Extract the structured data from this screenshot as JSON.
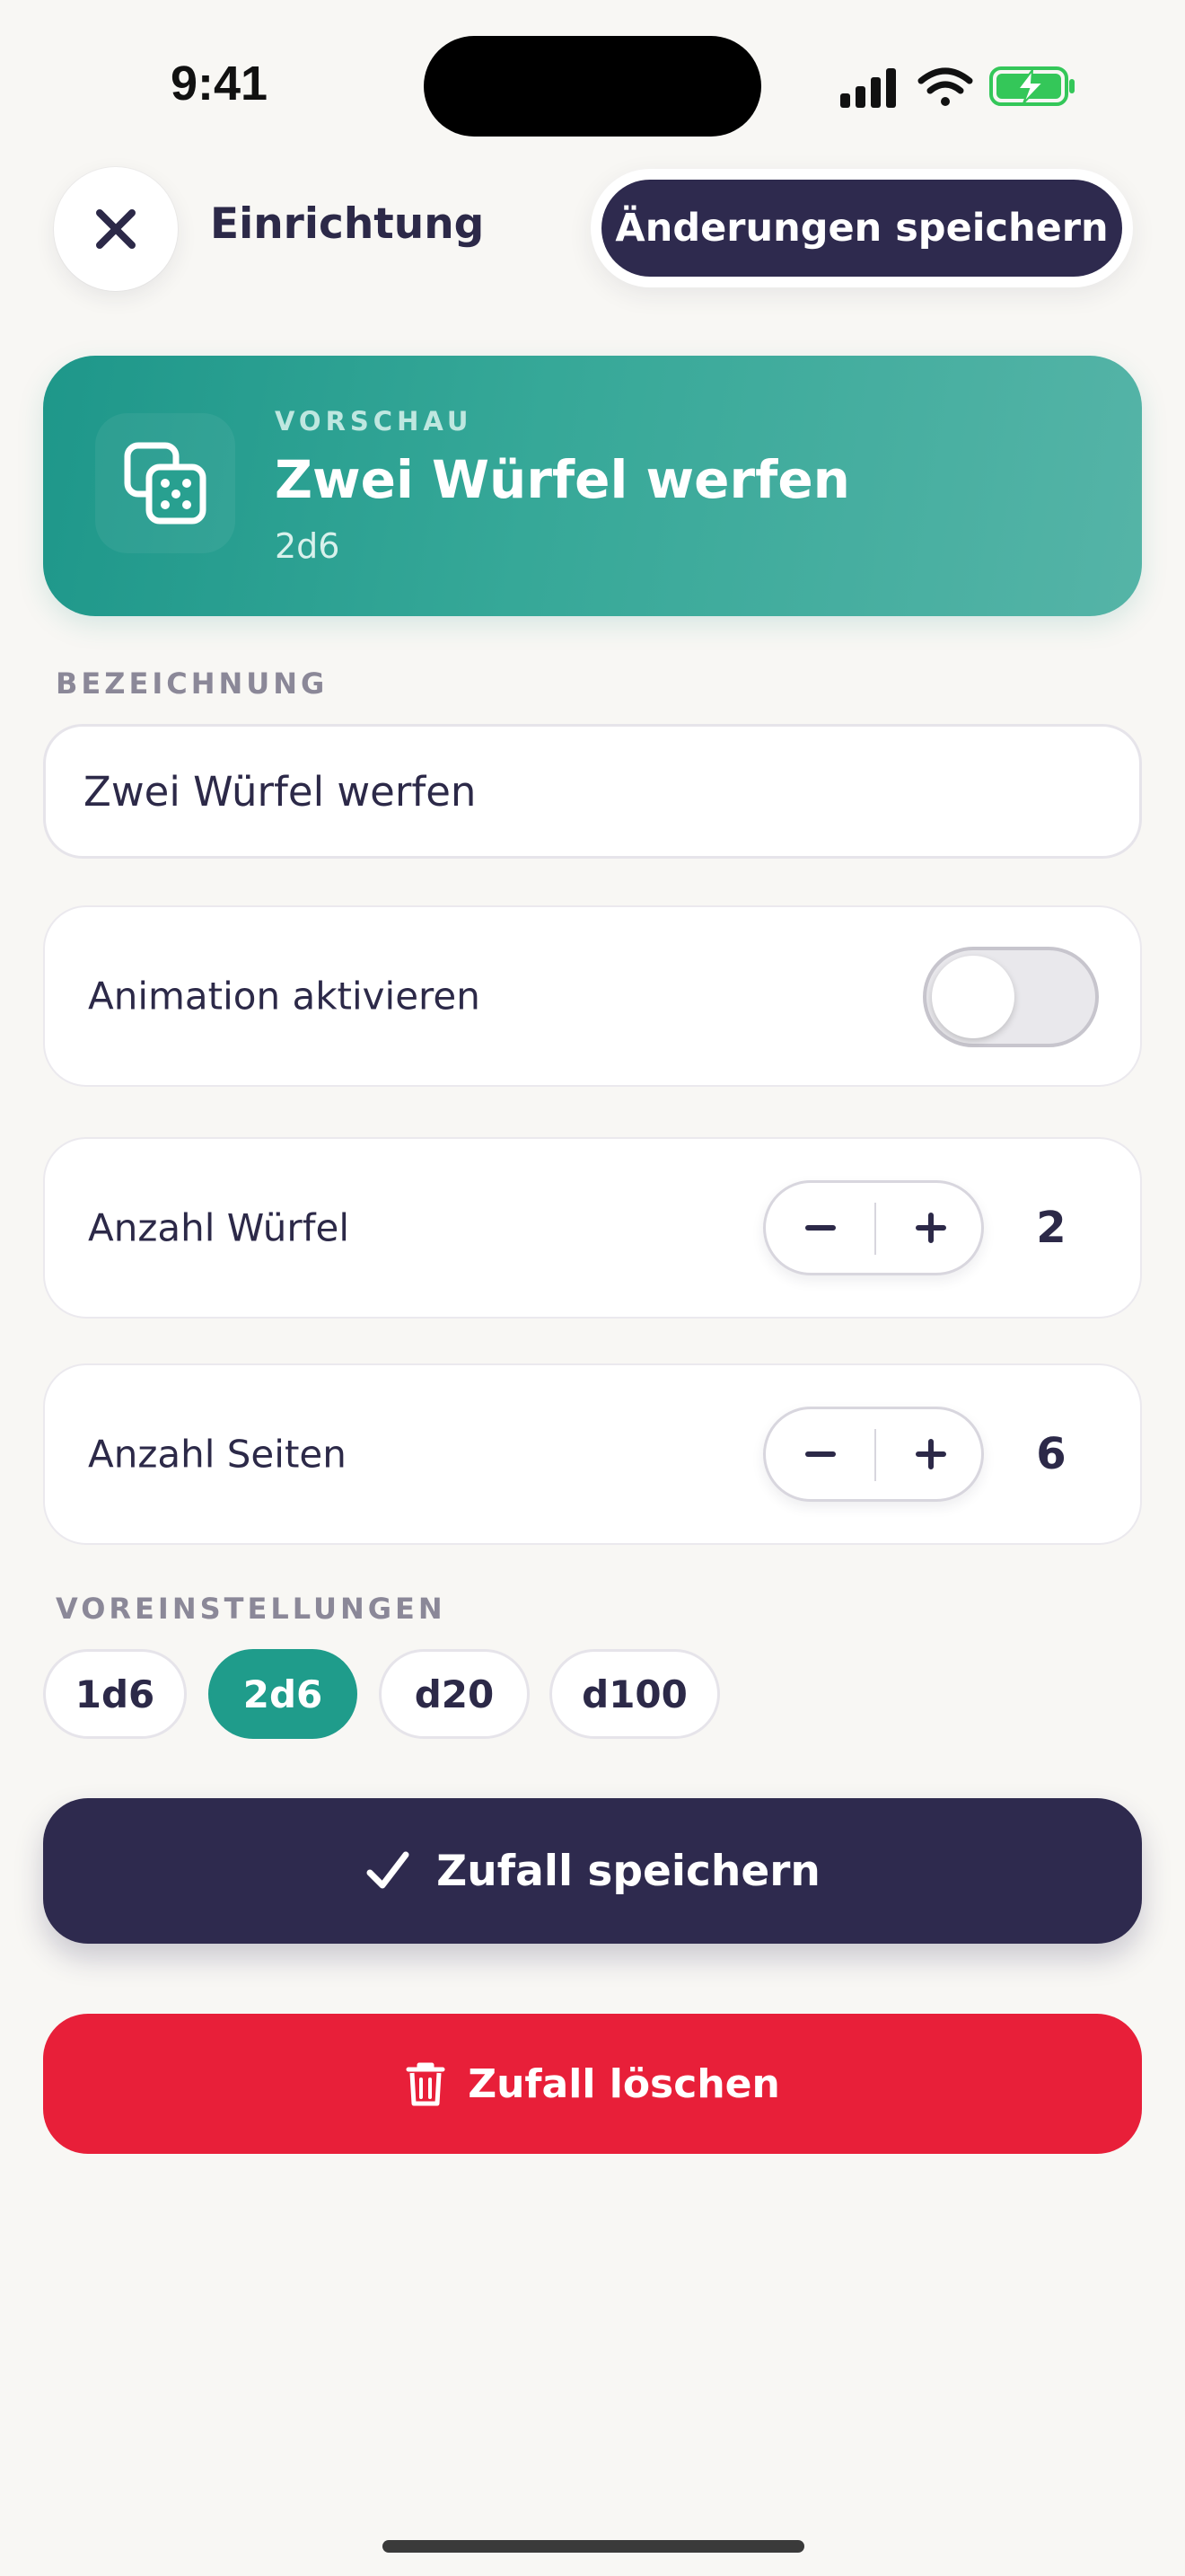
{
  "status_bar": {
    "time": "9:41"
  },
  "header": {
    "title": "Einrichtung",
    "save_changes_label": "Änderungen speichern"
  },
  "preview": {
    "kicker": "VORSCHAU",
    "title": "Zwei Würfel werfen",
    "notation": "2d6"
  },
  "name_section": {
    "label": "BEZEICHNUNG",
    "value": "Zwei Würfel werfen"
  },
  "animation": {
    "label": "Animation aktivieren",
    "enabled": false
  },
  "dice_count": {
    "label": "Anzahl Würfel",
    "value": "2"
  },
  "dice_sides": {
    "label": "Anzahl Seiten",
    "value": "6"
  },
  "presets": {
    "label": "VOREINSTELLUNGEN",
    "items": [
      "1d6",
      "2d6",
      "d20",
      "d100"
    ],
    "selected": "2d6"
  },
  "actions": {
    "save_label": "Zufall speichern",
    "delete_label": "Zufall löschen"
  },
  "colors": {
    "accent": "#1f9c8b",
    "primary": "#2e2a4e",
    "danger": "#e81f39",
    "background": "#f8f7f4"
  },
  "icons": [
    "close-icon",
    "dice-icon",
    "minus-icon",
    "plus-icon",
    "checkmark-icon",
    "trash-icon",
    "signal-icon",
    "wifi-icon",
    "battery-charging-icon"
  ]
}
